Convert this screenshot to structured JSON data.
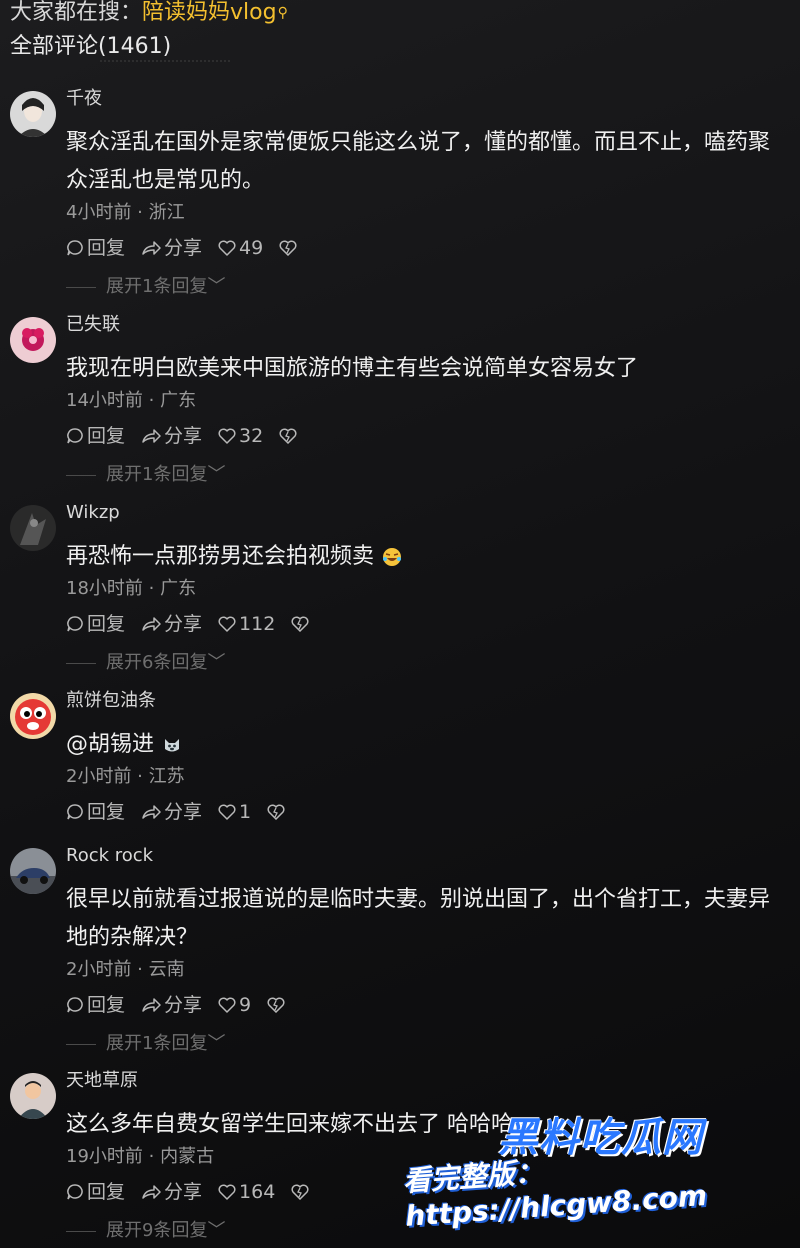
{
  "search": {
    "prefix": "大家都在搜：",
    "term": "陪读妈妈vlog"
  },
  "comments_header": "全部评论(1461)",
  "actions": {
    "reply": "回复",
    "share": "分享"
  },
  "comments": [
    {
      "user": "千夜",
      "text": "聚众淫乱在国外是家常便饭只能这么说了，懂的都懂。而且不止，嗑药聚众淫乱也是常见的。",
      "meta": "4小时前 · 浙江",
      "likes": "49",
      "expand": "展开1条回复"
    },
    {
      "user": "已失联",
      "text": "我现在明白欧美来中国旅游的博主有些会说简单女容易女了",
      "meta": "14小时前 · 广东",
      "likes": "32",
      "expand": "展开1条回复"
    },
    {
      "user": "Wikzp",
      "text": "再恐怖一点那捞男还会拍视频卖",
      "meta": "18小时前 · 广东",
      "likes": "112",
      "expand": "展开6条回复"
    },
    {
      "user": "煎饼包油条",
      "text": "@胡锡进",
      "meta": "2小时前 · 江苏",
      "likes": "1",
      "expand": ""
    },
    {
      "user": "Rock rock",
      "text": "很早以前就看过报道说的是临时夫妻。别说出国了，出个省打工，夫妻异地的杂解决？",
      "meta": "2小时前 · 云南",
      "likes": "9",
      "expand": "展开1条回复"
    },
    {
      "user": "天地草原",
      "text": "这么多年自费女留学生回来嫁不出去了 哈哈哈",
      "meta": "19小时前 · 内蒙古",
      "likes": "164",
      "expand": "展开9条回复"
    }
  ],
  "watermark": {
    "brand": "黑料吃瓜网",
    "url_text": "看完整版：https://hlcgw8.com"
  }
}
